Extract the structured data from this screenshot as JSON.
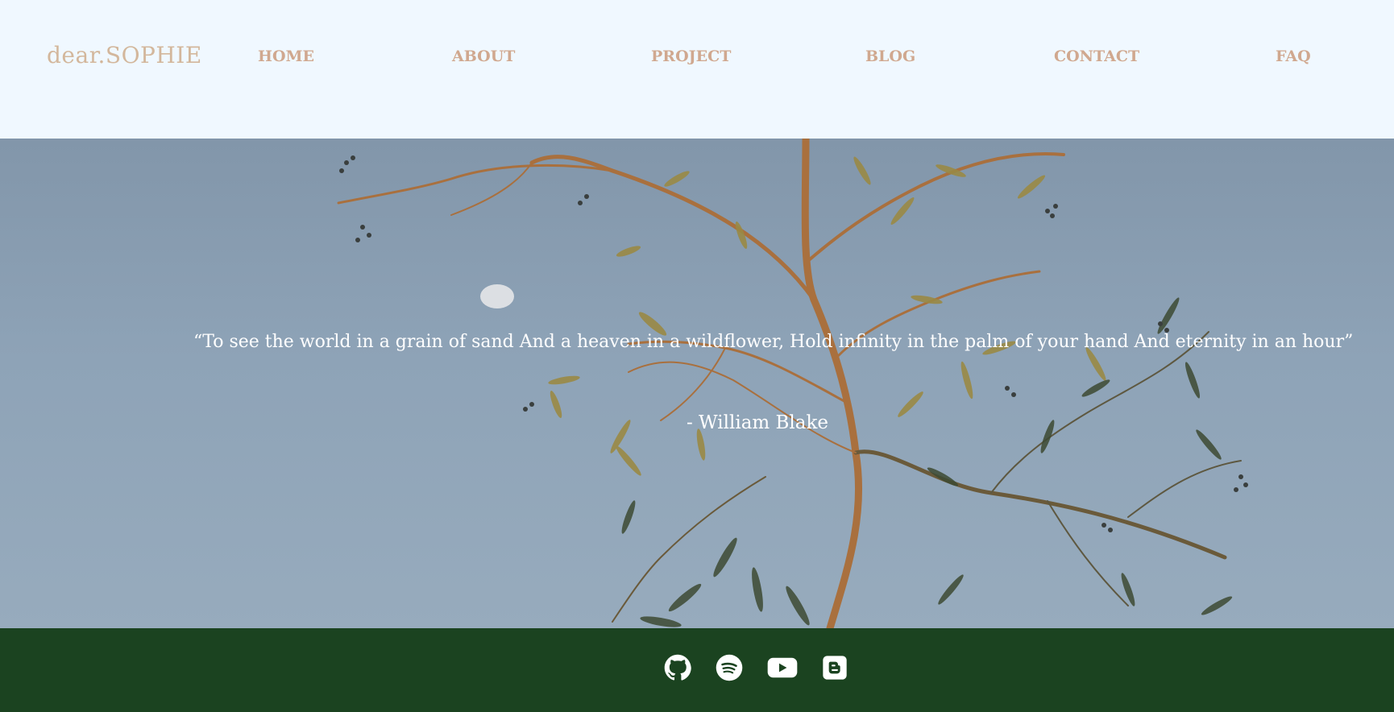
{
  "header": {
    "brand": "dear.SOPHIE",
    "nav": [
      {
        "label": "HOME"
      },
      {
        "label": "ABOUT"
      },
      {
        "label": "PROJECT"
      },
      {
        "label": "BLOG"
      },
      {
        "label": "CONTACT"
      },
      {
        "label": "FAQ"
      }
    ]
  },
  "hero": {
    "quote": "“To see the world in a grain of sand And a heaven in a wildflower, Hold infinity in the palm of your hand And eternity in an hour”",
    "author": "- William Blake"
  },
  "footer": {
    "social_icons": [
      "github-icon",
      "spotify-icon",
      "youtube-icon",
      "blogger-icon"
    ]
  },
  "colors": {
    "header_bg": "#f0f8ff",
    "nav_text": "#d0a88f",
    "brand_text": "#d3b79c",
    "footer_bg": "#1b4320",
    "sky": "#8ea3b7"
  }
}
